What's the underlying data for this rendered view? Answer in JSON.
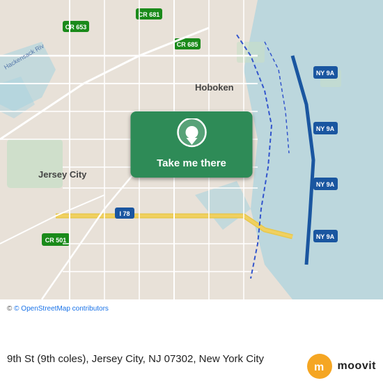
{
  "map": {
    "alt": "Map of Jersey City and Hoboken area, NJ"
  },
  "button": {
    "label": "Take me there",
    "pin_icon": "📍"
  },
  "bottom_bar": {
    "attribution": "© OpenStreetMap contributors",
    "location_text": "9th St (9th coles), Jersey City, NJ 07302, New York City"
  },
  "moovit": {
    "text": "moovit",
    "icon": "m"
  },
  "colors": {
    "green": "#2e8b57",
    "pin_white": "#ffffff",
    "map_road": "#f5f3ef",
    "map_water": "#aad3df",
    "map_green": "#c8e6c9",
    "moovit_orange": "#f5a623"
  }
}
